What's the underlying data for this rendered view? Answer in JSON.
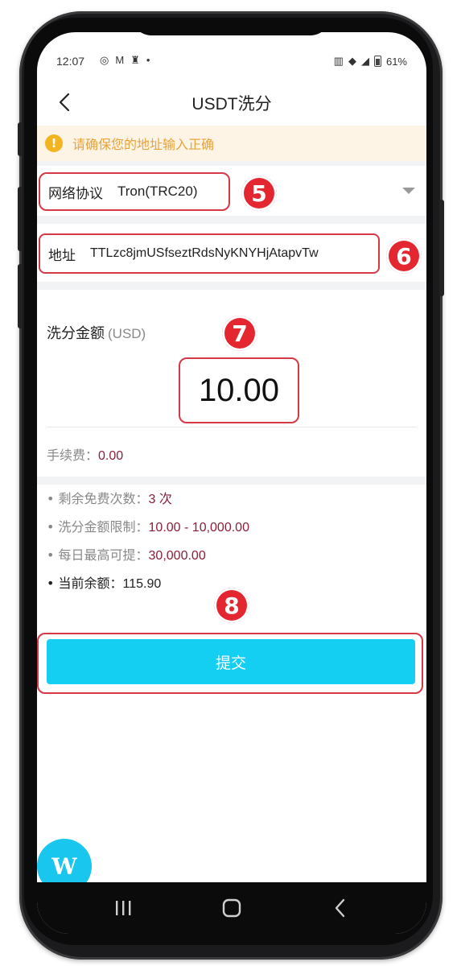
{
  "status_bar": {
    "time": "12:07",
    "battery": "61%"
  },
  "header": {
    "title": "USDT洗分"
  },
  "warning": {
    "icon": "!",
    "text": "请确保您的地址输入正确"
  },
  "network": {
    "label": "网络协议",
    "value": "Tron(TRC20)"
  },
  "address": {
    "label": "地址",
    "value": "TTLzc8jmUSfseztRdsNyKNYHjAtapvTw"
  },
  "amount": {
    "label": "洗分金额",
    "unit": "(USD)",
    "value": "10.00"
  },
  "fee": {
    "label": "手续费：",
    "value": "0.00"
  },
  "limits": [
    {
      "label": "• 剩余免费次数：",
      "value": "3 次"
    },
    {
      "label": "• 洗分金额限制：",
      "value": "10.00 - 10,000.00"
    },
    {
      "label": "• 每日最高可提：",
      "value": "30,000.00"
    },
    {
      "label": "• 当前余额：",
      "value": "115.90"
    }
  ],
  "submit": {
    "label": "提交"
  },
  "annotations": {
    "step5": "5",
    "step6": "6",
    "step7": "7",
    "step8": "8"
  },
  "floating_button": {
    "label": "W"
  },
  "colors": {
    "accent": "#14cff2",
    "highlight": "#d63946",
    "value_text": "#8a1f3a",
    "warning_bg": "#fdf4e6",
    "warning_text": "#e8a33a"
  }
}
